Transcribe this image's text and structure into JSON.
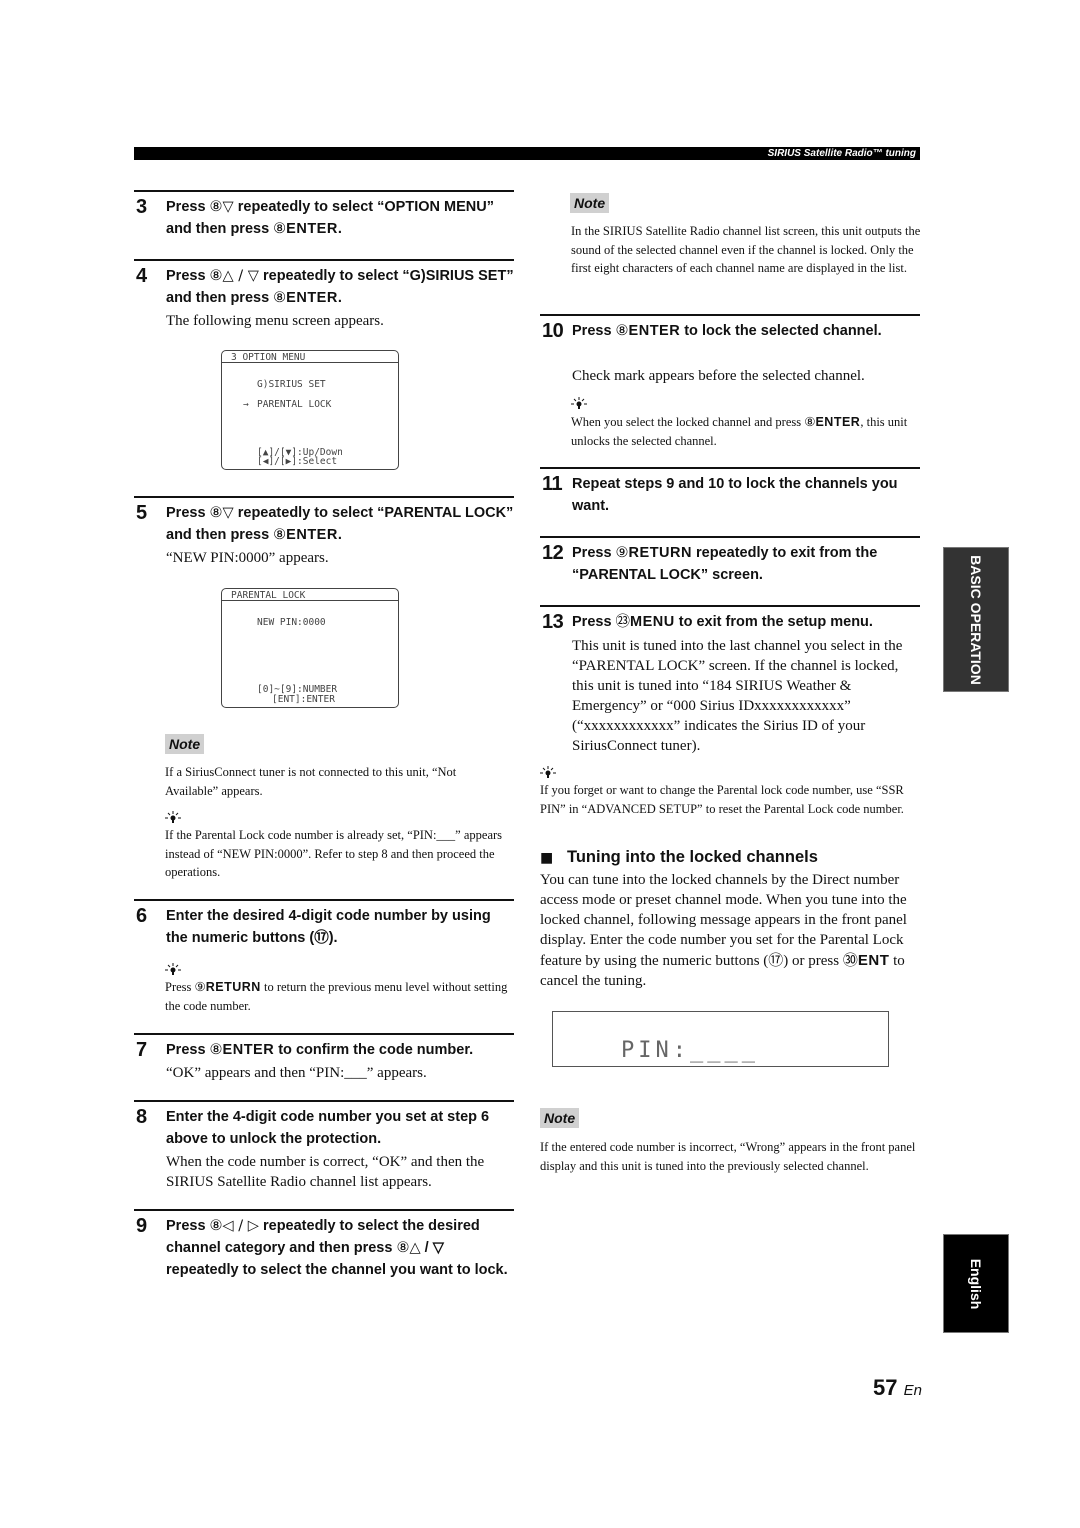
{
  "header": {
    "section_title": "SIRIUS Satellite Radio™ tuning"
  },
  "left_column": {
    "step3": {
      "num": "3",
      "title_a": "Press ",
      "key": "⑧",
      "arrow": "▽",
      "title_b": " repeatedly to select “OPTION MENU” and then press ",
      "key2": "⑧",
      "btn": "ENTER",
      "end": "."
    },
    "step4": {
      "num": "4",
      "title_a": "Press ",
      "key": "⑧",
      "arrow": "△ / ▽",
      "title_b": " repeatedly to select “G)SIRIUS SET” and then press ",
      "key2": "⑧",
      "btn": "ENTER",
      "end": ".",
      "body": "The following menu screen appears."
    },
    "osd1": {
      "header": "3 OPTION MENU",
      "line1": "G)SIRIUS SET",
      "cursor": "→",
      "line2": "PARENTAL LOCK",
      "help1": "[▲]/[▼]:Up/Down",
      "help2": "[◀]/[▶]:Select"
    },
    "step5": {
      "num": "5",
      "title_a": "Press ",
      "key": "⑧",
      "arrow": "▽",
      "title_b": " repeatedly to select “PARENTAL LOCK” and then press ",
      "key2": "⑧",
      "btn": "ENTER",
      "end": ".",
      "body": "“NEW PIN:0000” appears."
    },
    "osd2": {
      "header": "PARENTAL LOCK",
      "line1": "NEW PIN:0000",
      "help1": "[0]~[9]:NUMBER",
      "help2": "[ENT]:ENTER"
    },
    "note1": {
      "label": "Note",
      "text": "If a SiriusConnect tuner is not connected to this unit, “Not Available” appears."
    },
    "tip1": {
      "text": "If the Parental Lock code number is already set, “PIN:___” appears instead of “NEW PIN:0000”. Refer to step 8 and then proceed the operations."
    },
    "step6": {
      "num": "6",
      "title": "Enter the desired 4-digit code number by using the numeric buttons (⑰).",
      "tip_a": "Press ",
      "tip_key": "⑨",
      "tip_btn": "RETURN",
      "tip_b": " to return the previous menu level without setting the code number."
    },
    "step7": {
      "num": "7",
      "title_a": "Press ",
      "key": "⑧",
      "btn": "ENTER",
      "title_b": " to confirm the code number.",
      "body": "“OK” appears and then “PIN:___” appears."
    },
    "step8": {
      "num": "8",
      "title": "Enter the 4-digit code number you set at step 6 above to unlock the protection.",
      "body": "When the code number is correct, “OK” and then the SIRIUS Satellite Radio channel list appears."
    },
    "step9": {
      "num": "9",
      "title_a": "Press ",
      "key": "⑧",
      "arrow": "◁ / ▷",
      "title_b": " repeatedly to select the desired channel category and then press ",
      "key2": "⑧",
      "arrow2": "△",
      "title_c": " / ▽ repeatedly to select the channel you want to lock."
    }
  },
  "right_column": {
    "note2": {
      "label": "Note",
      "text": "In the SIRIUS Satellite Radio channel list screen, this unit outputs the sound of the selected channel even if the channel is locked. Only the first eight characters of each channel name are displayed in the list."
    },
    "step10": {
      "num": "10",
      "title_a": "Press ",
      "key": "⑧",
      "btn": "ENTER",
      "title_b": " to lock the selected channel.",
      "body": "Check mark appears before the selected channel.",
      "tip_a": "When you select the locked channel and press ",
      "tip_key": "⑧",
      "tip_btn": "ENTER",
      "tip_b": ", this unit unlocks the selected channel."
    },
    "step11": {
      "num": "11",
      "title": "Repeat steps 9 and 10 to lock the channels you want."
    },
    "step12": {
      "num": "12",
      "title_a": "Press ",
      "key": "⑨",
      "btn": "RETURN",
      "title_b": " repeatedly to exit from the “PARENTAL LOCK” screen."
    },
    "step13": {
      "num": "13",
      "title_a": "Press ",
      "key": "㉓",
      "btn": "MENU",
      "title_b": " to exit from the setup menu.",
      "body": "This unit is tuned into the last channel you select in the “PARENTAL LOCK” screen. If the channel is locked, this unit is tuned into “184 SIRIUS Weather & Emergency” or “000 Sirius IDxxxxxxxxxxxx” (“xxxxxxxxxxxx” indicates the Sirius ID of your SiriusConnect tuner)."
    },
    "tip3": {
      "text": "If you forget or want to change the Parental lock code number, use “SSR PIN” in “ADVANCED SETUP” to reset the Parental Lock code number."
    },
    "section": {
      "bullet": "■",
      "title": "Tuning into the locked channels",
      "body_a": "You can tune into the locked channels by the Direct number access mode or preset channel mode. When you tune into the locked channel, following message appears in the front panel display. Enter the code number you set for the Parental Lock feature by using the numeric buttons (⑰) or press ",
      "key": "㉚",
      "btn": "ENT",
      "body_b": " to cancel the tuning."
    },
    "display": {
      "text": "PIN:____"
    },
    "note3": {
      "label": "Note",
      "text": "If the entered code number is incorrect, “Wrong” appears in the front panel display and this unit is tuned into the previously selected channel."
    }
  },
  "side_tabs": {
    "basic_operation": "BASIC OPERATION",
    "english": "English"
  },
  "footer": {
    "page_number": "57",
    "lang": "En"
  },
  "colors": {
    "header_bar": "#000000",
    "note_badge": "#d0d0d0",
    "basic_tab": "#333333",
    "english_tab": "#000000"
  }
}
